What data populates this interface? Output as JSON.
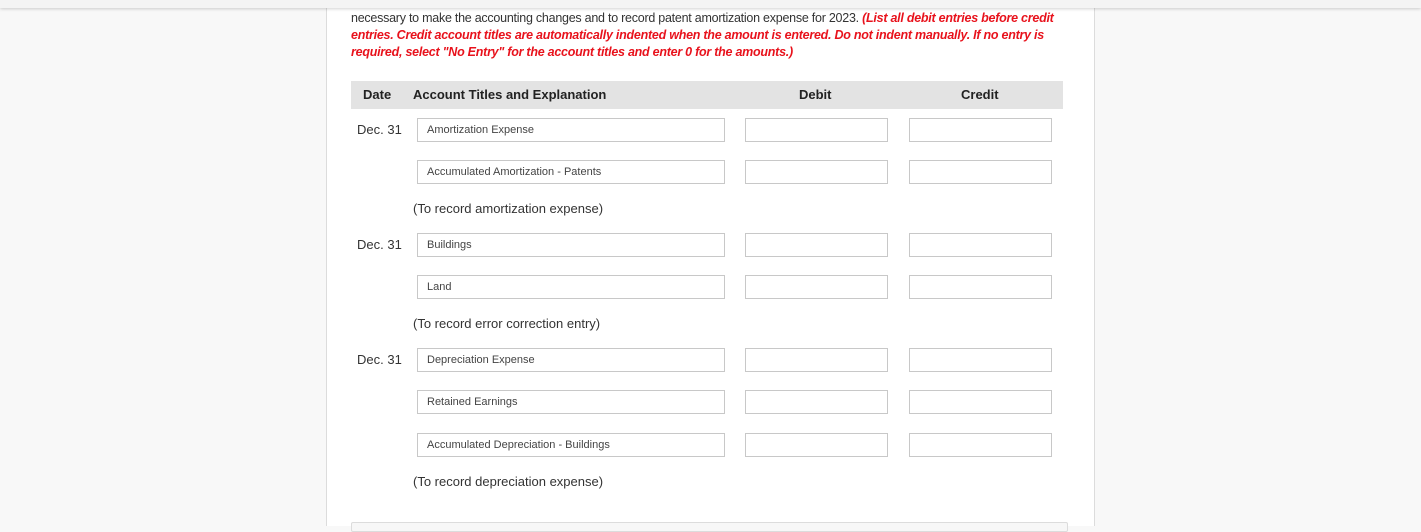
{
  "instructions": {
    "plain": "necessary to make the accounting changes and to record patent amortization expense for 2023. ",
    "emphasis": "(List all debit entries before credit entries. Credit account titles are automatically indented when the amount is entered. Do not indent manually. If no entry is required, select \"No Entry\" for the account titles and enter 0 for the amounts.)"
  },
  "table": {
    "headers": {
      "date": "Date",
      "account": "Account Titles and Explanation",
      "debit": "Debit",
      "credit": "Credit"
    },
    "entries": [
      {
        "date": "Dec. 31",
        "lines": [
          {
            "account": "Amortization Expense",
            "debit": "",
            "credit": ""
          },
          {
            "account": "Accumulated Amortization - Patents",
            "debit": "",
            "credit": ""
          }
        ],
        "explanation": "(To record amortization expense)"
      },
      {
        "date": "Dec. 31",
        "lines": [
          {
            "account": "Buildings",
            "debit": "",
            "credit": ""
          },
          {
            "account": "Land",
            "debit": "",
            "credit": ""
          }
        ],
        "explanation": "(To record error correction entry)"
      },
      {
        "date": "Dec. 31",
        "lines": [
          {
            "account": "Depreciation Expense",
            "debit": "",
            "credit": ""
          },
          {
            "account": "Retained Earnings",
            "debit": "",
            "credit": ""
          },
          {
            "account": "Accumulated Depreciation - Buildings",
            "debit": "",
            "credit": ""
          }
        ],
        "explanation": "(To record depreciation expense)"
      }
    ]
  },
  "colors": {
    "instruction_emphasis": "#e8121c",
    "header_bg": "#e3e3e3"
  }
}
